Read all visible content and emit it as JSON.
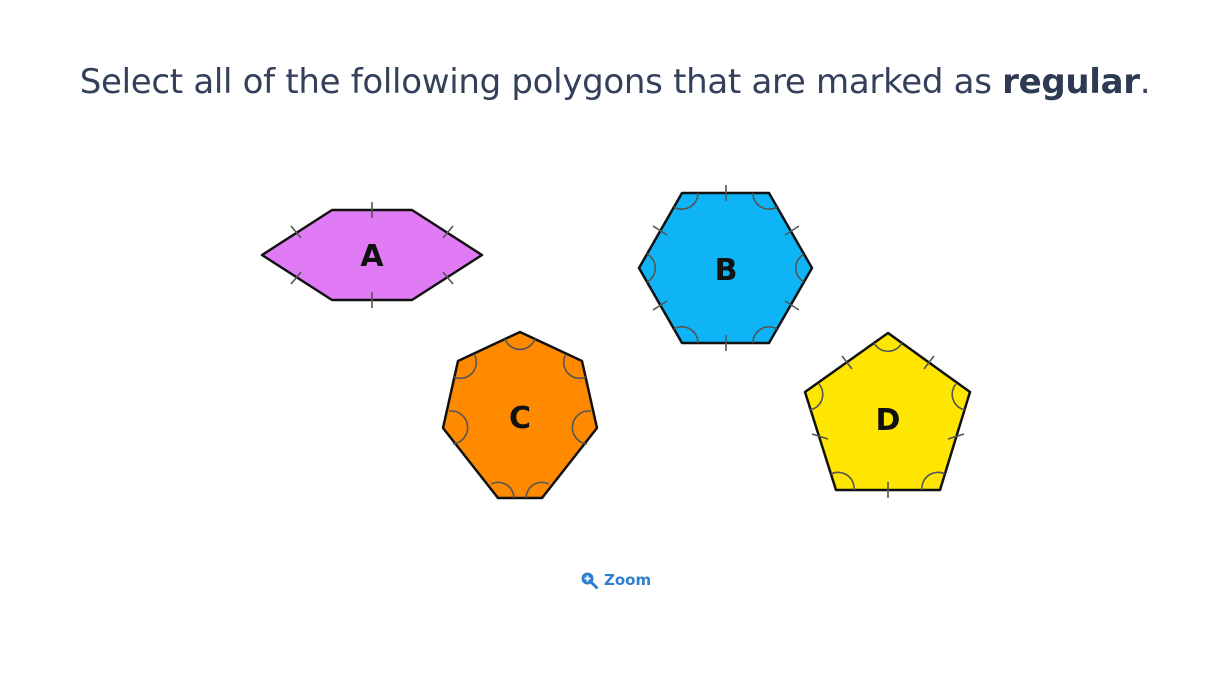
{
  "question": {
    "prefix": "Select all of the following polygons that are marked as ",
    "emphasis": "regular",
    "suffix": "."
  },
  "shapes": [
    {
      "id": "A",
      "label": "A",
      "sides": 6,
      "fill": "#e07af5"
    },
    {
      "id": "B",
      "label": "B",
      "sides": 6,
      "fill": "#0eb4f5"
    },
    {
      "id": "C",
      "label": "C",
      "sides": 7,
      "fill": "#ff8a00"
    },
    {
      "id": "D",
      "label": "D",
      "sides": 5,
      "fill": "#ffe600"
    }
  ],
  "zoom": {
    "label": "Zoom",
    "icon": "zoom-in-icon",
    "color": "#2f7fd1"
  }
}
